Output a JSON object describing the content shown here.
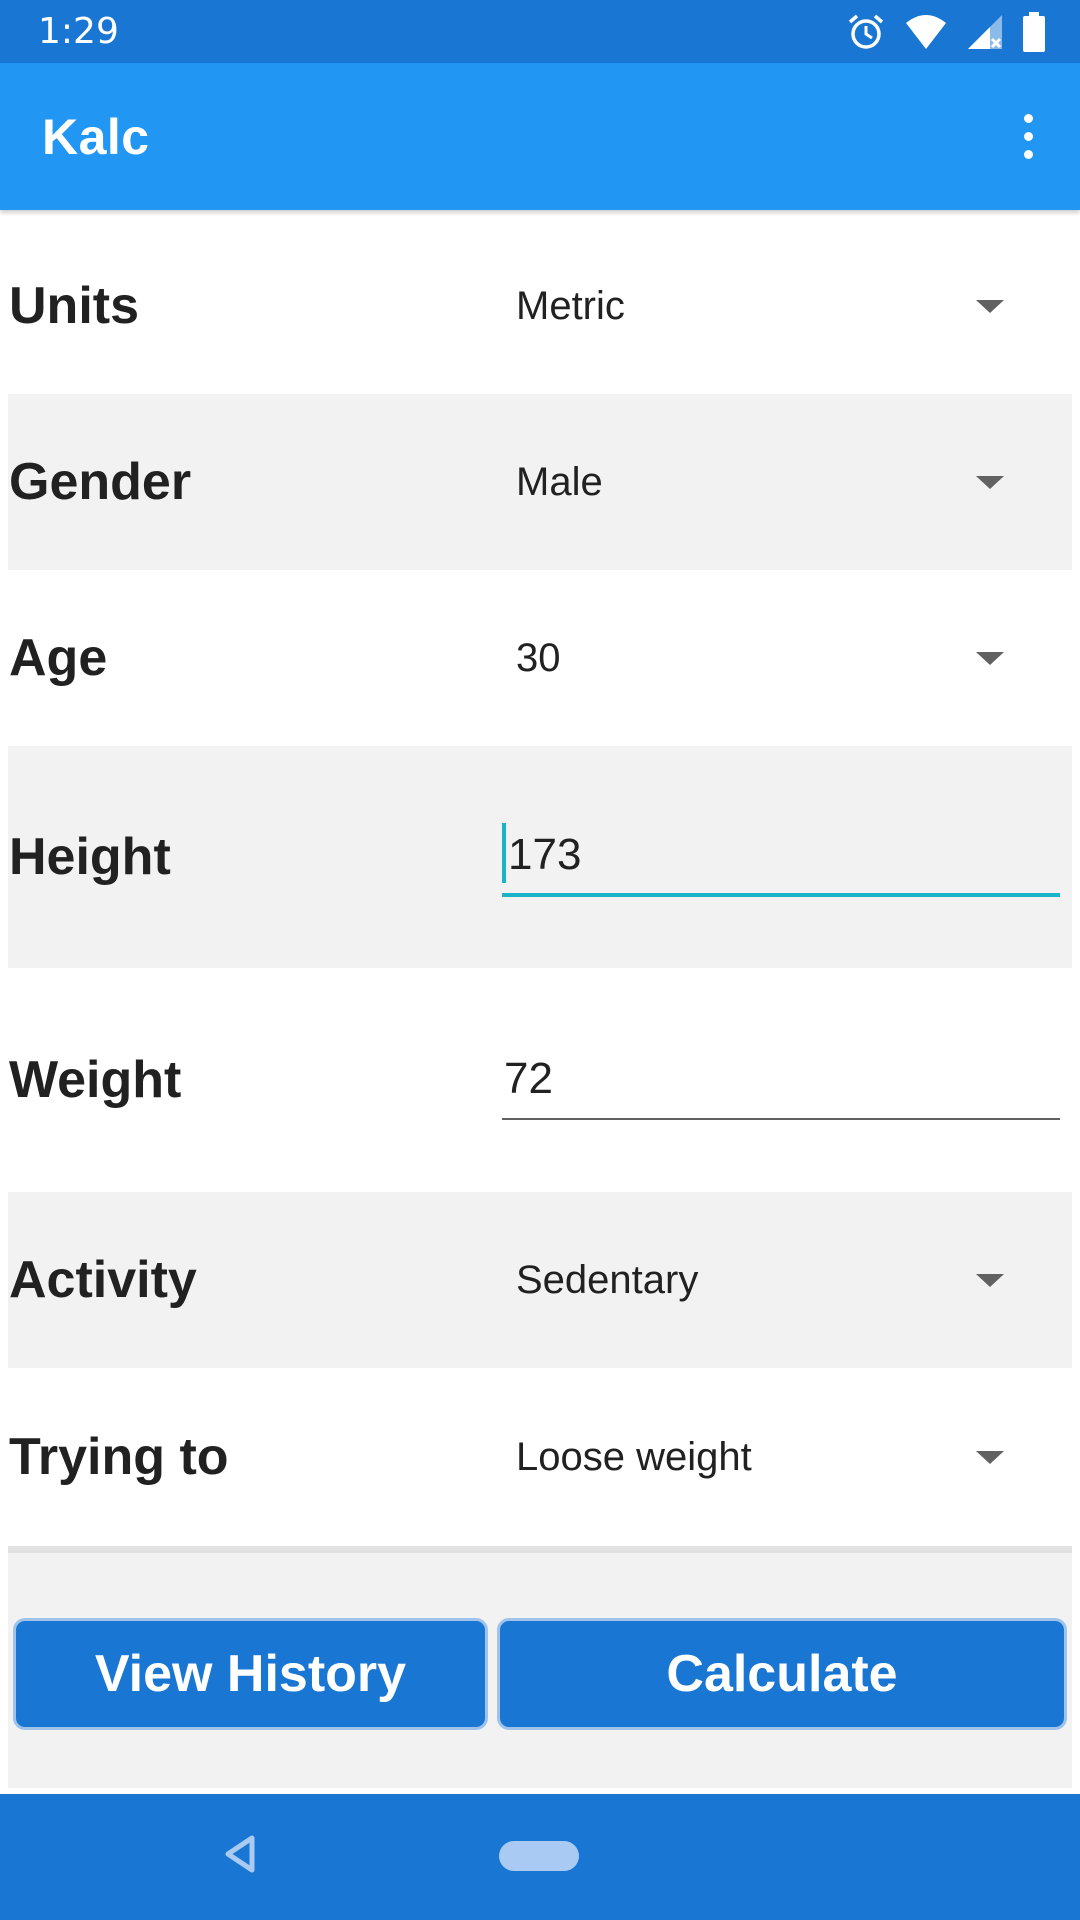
{
  "status_bar": {
    "time": "1:29",
    "icons": [
      "alarm-icon",
      "wifi-icon",
      "signal-no-data-icon",
      "battery-icon"
    ]
  },
  "app_bar": {
    "title": "Kalc",
    "menu_icon": "more-vert-icon"
  },
  "form": {
    "units": {
      "label": "Units",
      "value": "Metric"
    },
    "gender": {
      "label": "Gender",
      "value": "Male"
    },
    "age": {
      "label": "Age",
      "value": "30"
    },
    "height": {
      "label": "Height",
      "value": "173"
    },
    "weight": {
      "label": "Weight",
      "value": "72"
    },
    "activity": {
      "label": "Activity",
      "value": "Sedentary"
    },
    "goal": {
      "label": "Trying to",
      "value": "Loose weight"
    }
  },
  "buttons": {
    "history_label": "View History",
    "calculate_label": "Calculate"
  },
  "nav_bar": {
    "icons": [
      "back-icon",
      "home-pill-icon"
    ]
  },
  "colors": {
    "status_bar": "#1976d2",
    "app_bar": "#2196f3",
    "button": "#1976d2",
    "focus_accent": "#1ab3c8",
    "shaded_row": "#f2f2f2"
  }
}
